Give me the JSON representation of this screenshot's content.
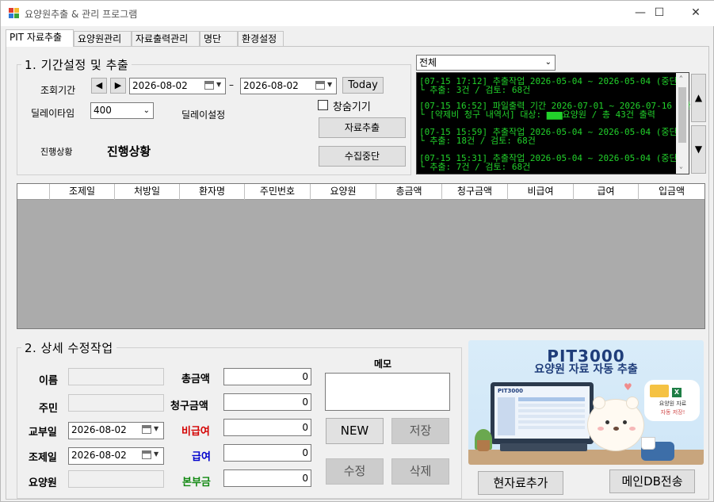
{
  "window": {
    "title": "요양원추출 & 관리 프로그램",
    "minimize": "—",
    "maximize": "☐",
    "close": "✕"
  },
  "tabs": [
    "PIT 자료추출",
    "요양원관리",
    "자료출력관리",
    "명단",
    "환경설정"
  ],
  "period": {
    "group_title": "1. 기간설정 및 추출",
    "query_label": "조회기간",
    "prev": "◀",
    "next": "▶",
    "start_date": "2026-08-02",
    "dash": "–",
    "end_date": "2026-08-02",
    "today_button": "Today",
    "delay_label": "딜레이타임",
    "delay_value": "400",
    "delay_setting_label": "딜레이설정",
    "hide_window_label": "창숨기기",
    "extract_button": "자료추출",
    "stop_button": "수집중단",
    "progress_label": "진행상황",
    "progress_value": "진행상황"
  },
  "filter": {
    "selected": "전체"
  },
  "log": {
    "lines": [
      "[07-15 17:12] 추출작업 2026-05-04 ~ 2026-05-04 (중단)",
      "  └ 추출: 3건 / 검토: 68건",
      "[07-15 16:52] 파일출력 기간 2026-07-01 ~ 2026-07-16 (완료)",
      "  └ [약제비 청구 내역서] 대상: ▆▆▆요양원 / 총 43건 출력",
      "[07-15 15:59] 추출작업 2026-05-04 ~ 2026-05-04 (중단)",
      "  └ 추출: 18건 / 검토: 68건",
      "[07-15 15:31] 추출작업 2026-05-04 ~ 2026-05-04 (중단)",
      "  └ 추출: 7건 / 검토: 68건"
    ],
    "scroll_up": "▲",
    "scroll_down": "▼"
  },
  "grid": {
    "columns": [
      "",
      "조제일",
      "처방일",
      "환자명",
      "주민번호",
      "요양원",
      "총금액",
      "청구금액",
      "비급여",
      "급여",
      "입금액"
    ]
  },
  "detail": {
    "group_title": "2. 상세 수정작업",
    "name_label": "이름",
    "resident_label": "주민",
    "issue_date_label": "교부일",
    "issue_date": "2026-08-02",
    "dispense_date_label": "조제일",
    "dispense_date": "2026-08-02",
    "nursing_home_label": "요양원",
    "total_label": "총금액",
    "total_value": "0",
    "claim_label": "청구금액",
    "claim_value": "0",
    "nonpay_label": "비급여",
    "nonpay_value": "0",
    "pay_label": "급여",
    "pay_value": "0",
    "copay_label": "본부금",
    "copay_value": "0",
    "memo_label": "메모",
    "new_button": "NEW",
    "save_button": "저장",
    "edit_button": "수정",
    "delete_button": "삭제"
  },
  "banner": {
    "title": "PIT3000",
    "subtitle": "요양원 자료 자동 추출",
    "screen_title": "PIT3000",
    "folder_text_1": "요양원 자료",
    "folder_text_2": "자동 저장!"
  },
  "bottom": {
    "add_current_button": "현자료추가",
    "send_db_button": "메인DB전송"
  },
  "colors": {
    "nonpay": "#d40000",
    "pay": "#0000cc",
    "copay": "#118811",
    "log_text": "#22d12b"
  }
}
